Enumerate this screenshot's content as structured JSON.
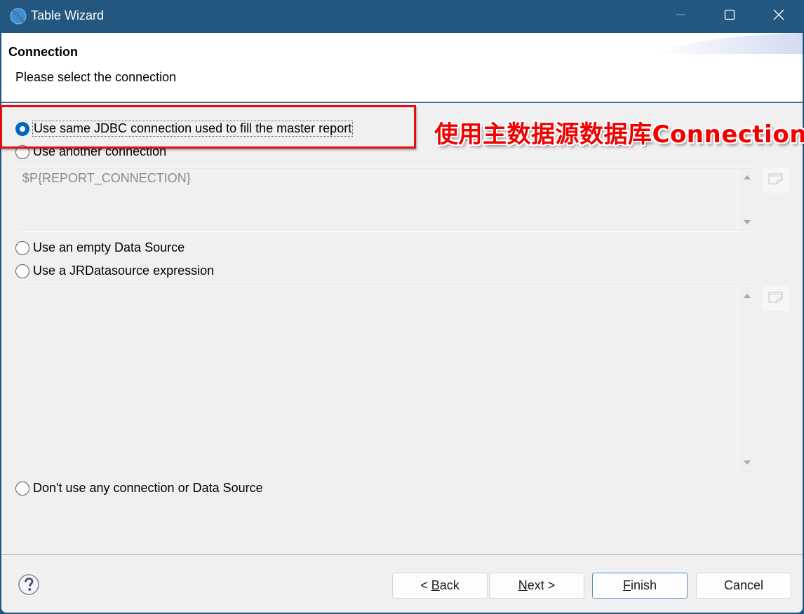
{
  "window": {
    "title": "Table Wizard",
    "app_icon": "app-logo-icon",
    "controls": [
      "minimize-icon",
      "maximize-icon",
      "close-icon"
    ]
  },
  "header": {
    "title": "Connection",
    "description": "Please select the connection"
  },
  "options": [
    {
      "label": "Use same JDBC connection used to fill the master report",
      "checked": true
    },
    {
      "label": "Use another connection",
      "checked": false
    },
    {
      "label": "Use an empty Data Source",
      "checked": false
    },
    {
      "label": "Use a JRDatasource expression",
      "checked": false
    },
    {
      "label": "Don't use any connection or Data Source",
      "checked": false
    }
  ],
  "connection_expression": {
    "value": "$P{REPORT_CONNECTION}",
    "enabled": false
  },
  "datasource_expression": {
    "value": "",
    "enabled": false
  },
  "annotation": {
    "text": "使用主数据源数据库Connection",
    "color": "#f00000"
  },
  "footer": {
    "help_icon": "help-icon",
    "buttons": {
      "back": {
        "prefix": "< ",
        "mnemonic": "B",
        "rest": "ack"
      },
      "next": {
        "prefix": "",
        "mnemonic": "N",
        "rest": "ext >"
      },
      "finish": {
        "prefix": "",
        "mnemonic": "F",
        "rest": "inish"
      },
      "cancel": {
        "label": "Cancel"
      }
    }
  },
  "colors": {
    "titlebar": "#23577f",
    "accent": "#0067c0",
    "annotation": "#e01010"
  }
}
